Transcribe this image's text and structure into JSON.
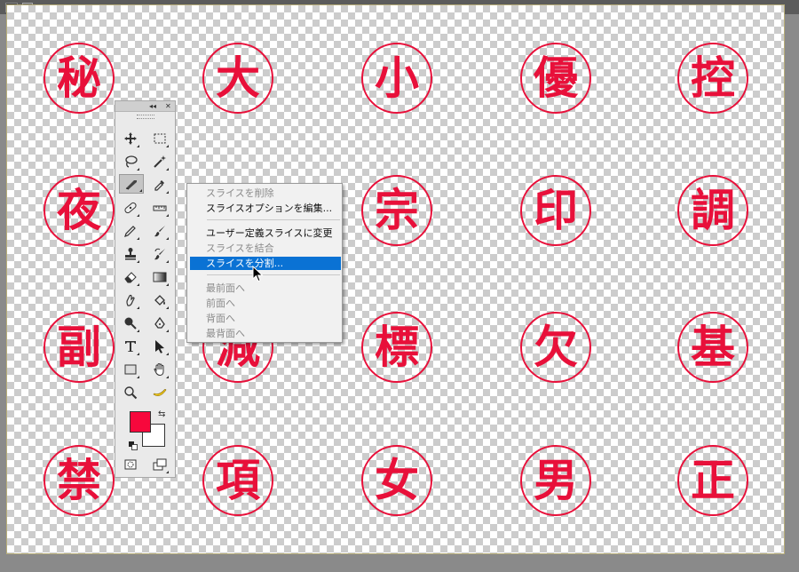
{
  "window": {
    "slice_number": "01"
  },
  "stamps": [
    "秘",
    "大",
    "小",
    "優",
    "控",
    "夜",
    "宗",
    "印",
    "調",
    "副",
    "減",
    "標",
    "欠",
    "基",
    "禁",
    "項",
    "女",
    "男",
    "正"
  ],
  "toolbox": {
    "collapse_glyph": "◂◂",
    "close_glyph": "✕",
    "foreground_color": "#f7083c",
    "background_color": "#ffffff",
    "tools": [
      "move-icon",
      "marquee-icon",
      "lasso-icon",
      "magic-wand-icon",
      "slice-icon",
      "eyedropper-icon",
      "healing-brush-icon",
      "ruler-icon",
      "pencil-icon",
      "brush-icon",
      "clone-stamp-icon",
      "history-brush-icon",
      "eraser-icon",
      "gradient-icon",
      "smudge-icon",
      "paint-bucket-icon",
      "dodge-icon",
      "pen-icon",
      "type-icon",
      "path-selection-icon",
      "rectangle-icon",
      "hand-icon",
      "zoom-icon",
      "banana-icon",
      "quick-mask-icon",
      "screen-mode-icon"
    ]
  },
  "context_menu": {
    "items": [
      {
        "label": "スライスを削除",
        "state": "disabled"
      },
      {
        "label": "スライスオプションを編集...",
        "state": "enabled"
      },
      {
        "label": "ユーザー定義スライスに変更",
        "state": "enabled"
      },
      {
        "label": "スライスを結合",
        "state": "disabled"
      },
      {
        "label": "スライスを分割...",
        "state": "highlighted"
      },
      {
        "label": "最前面へ",
        "state": "disabled"
      },
      {
        "label": "前面へ",
        "state": "disabled"
      },
      {
        "label": "背面へ",
        "state": "disabled"
      },
      {
        "label": "最背面へ",
        "state": "disabled"
      }
    ]
  },
  "colors": {
    "stamp_red": "#e8103a",
    "menu_highlight": "#0a72d4"
  }
}
